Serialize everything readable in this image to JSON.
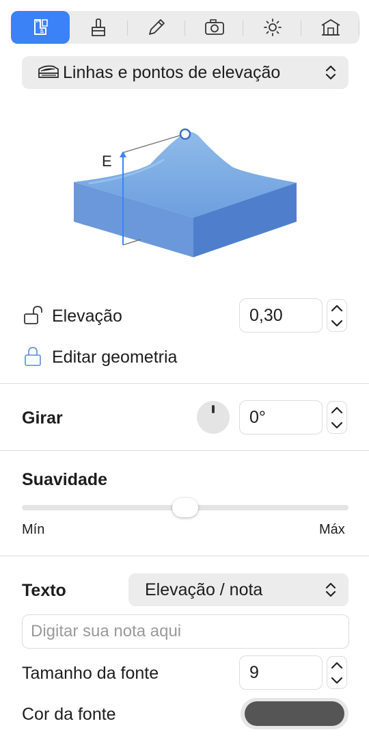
{
  "tabs": [
    {
      "icon": "plan-ruler-icon",
      "active": true
    },
    {
      "icon": "paint-brush-icon",
      "active": false
    },
    {
      "icon": "pencil-icon",
      "active": false
    },
    {
      "icon": "camera-icon",
      "active": false
    },
    {
      "icon": "sun-icon",
      "active": false
    },
    {
      "icon": "house-icon",
      "active": false
    }
  ],
  "category": {
    "icon": "terrain-layers-icon",
    "label": "Linhas e pontos de elevação"
  },
  "illustration": {
    "label": "E"
  },
  "elevation": {
    "label": "Elevação",
    "value": "0,30",
    "lock_icon": "unlock-icon"
  },
  "edit_geometry": {
    "label": "Editar geometria",
    "lock_icon": "lock-icon"
  },
  "rotate": {
    "label": "Girar",
    "value": "0°"
  },
  "smoothness": {
    "label": "Suavidade",
    "min": "Mín",
    "max": "Máx",
    "level": 0.5
  },
  "text": {
    "label": "Texto",
    "selected": "Elevação / nota",
    "placeholder": "Digitar sua nota aqui"
  },
  "font_size": {
    "label": "Tamanho da fonte",
    "value": "9"
  },
  "font_color": {
    "label": "Cor da fonte",
    "color": "#555555"
  },
  "colors": {
    "accent": "#3b82f6",
    "terrain_top": "#7fb0e6",
    "terrain_front": "#5f8fd6"
  }
}
